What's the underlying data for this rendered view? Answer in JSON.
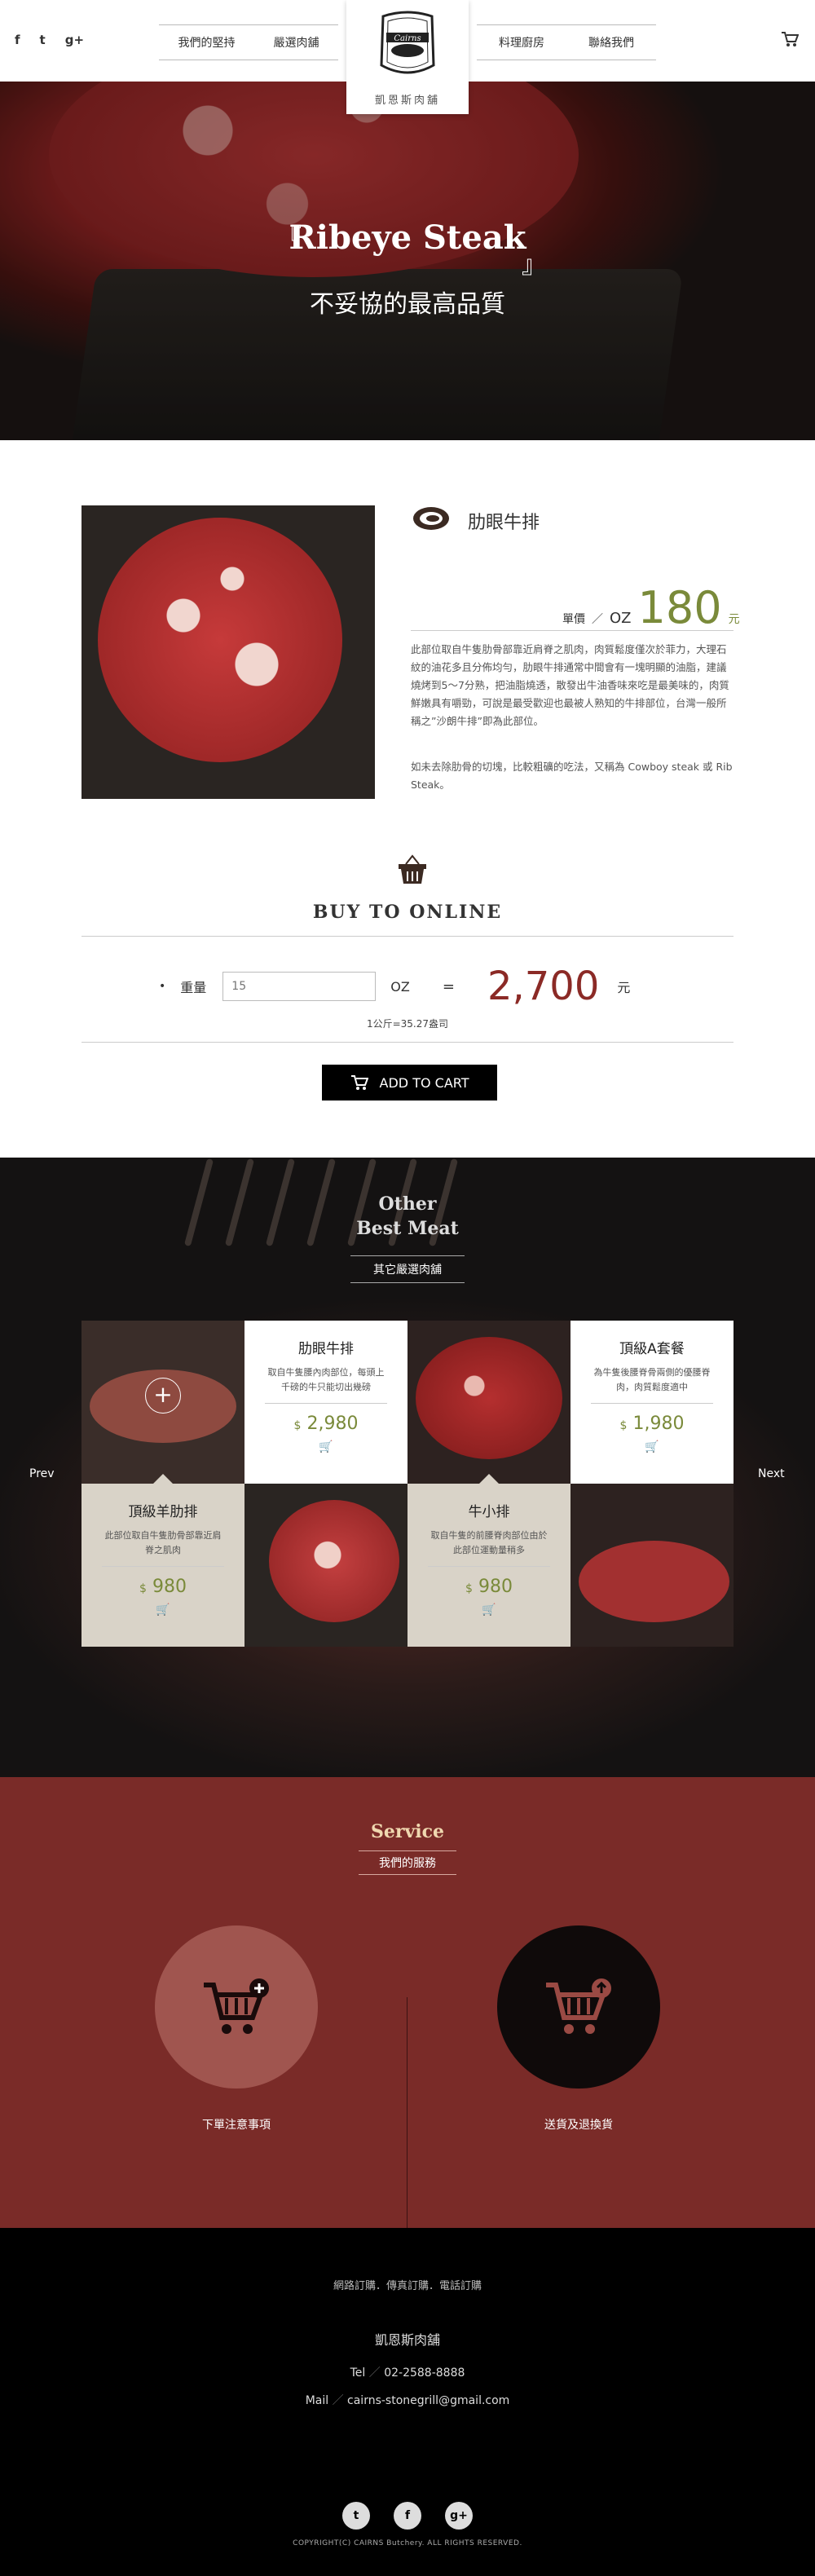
{
  "header": {
    "social": [
      "f",
      "t",
      "g+"
    ],
    "nav_left": [
      "我們的堅持",
      "嚴選肉舖"
    ],
    "nav_right": [
      "料理廚房",
      "聯絡我們"
    ],
    "logo_text": "Cairns",
    "brand_name": "凱恩斯肉舖"
  },
  "hero": {
    "title": "Ribeye Steak",
    "subtitle": "不妥協的最高品質",
    "bracket_open": "『",
    "bracket_close": "』"
  },
  "product": {
    "name": "肋眼牛排",
    "price_label": "單價",
    "price_sep": "／",
    "price_unit": "OZ",
    "price": "180",
    "currency": "元",
    "desc1": "此部位取自牛隻肋骨部靠近肩脊之肌肉，肉質鬆度僅次於菲力，大理石紋的油花多且分佈均勻，肋眼牛排通常中間會有一塊明顯的油脂，建議燒烤到5～7分熟，把油脂燒透，散發出牛油香味來吃是最美味的，肉質鮮嫩具有嚼勁，可說是最受歡迎也最被人熟知的牛排部位，台灣一般所稱之”沙朗牛排”即為此部位。",
    "desc2": "如未去除肋骨的切塊，比較粗礦的吃法，又稱為 Cowboy steak 或 Rib Steak。"
  },
  "buy": {
    "title": "BUY TO ONLINE",
    "bullet": "•",
    "weight_label": "重量",
    "weight_value": "15",
    "unit": "OZ",
    "equals": "=",
    "total": "2,700",
    "currency": "元",
    "conversion": "1公斤=35.27盎司",
    "add_to_cart": "ADD TO CART"
  },
  "other": {
    "title_line1": "Other",
    "title_line2": "Best Meat",
    "subtitle": "其它嚴選肉舖",
    "prev": "Prev",
    "next": "Next",
    "plus": "+",
    "cards": [
      {
        "name": "肋眼牛排",
        "desc": "取自牛隻腰內肉部位，每頭上千磅的牛只能切出幾磅",
        "price_symbol": "$",
        "price": "2,980"
      },
      {
        "name": "頂級A套餐",
        "desc": "為牛隻後腰脊骨兩側的優腰脊肉，肉質鬆度適中",
        "price_symbol": "$",
        "price": "1,980"
      },
      {
        "name": "頂級羊肋排",
        "desc": "此部位取自牛隻肋骨部靠近肩脊之肌肉",
        "price_symbol": "$",
        "price": "980"
      },
      {
        "name": "牛小排",
        "desc": "取自牛隻的前腰脊肉部位由於此部位運動量稍多",
        "price_symbol": "$",
        "price": "980"
      }
    ]
  },
  "service": {
    "title": "Service",
    "subtitle": "我們的服務",
    "left_label": "下單注意事項",
    "right_label": "送貨及退換貨"
  },
  "footer": {
    "order_methods": "網路訂購．傳真訂購．電話訂購",
    "brand": "凱恩斯肉舖",
    "tel_label": "Tel",
    "tel": "02-2588-8888",
    "mail_label": "Mail",
    "mail": "cairns-stonegrill@gmail.com",
    "separator": "／",
    "social": [
      "t",
      "f",
      "g+"
    ],
    "copyright": "COPYRIGHT(C) CAIRNS Butchery. ALL RIGHTS RESERVED."
  },
  "colors": {
    "price_green": "#7a8a3a",
    "total_red": "#8b2a26",
    "service_bg": "#7a2b28"
  }
}
